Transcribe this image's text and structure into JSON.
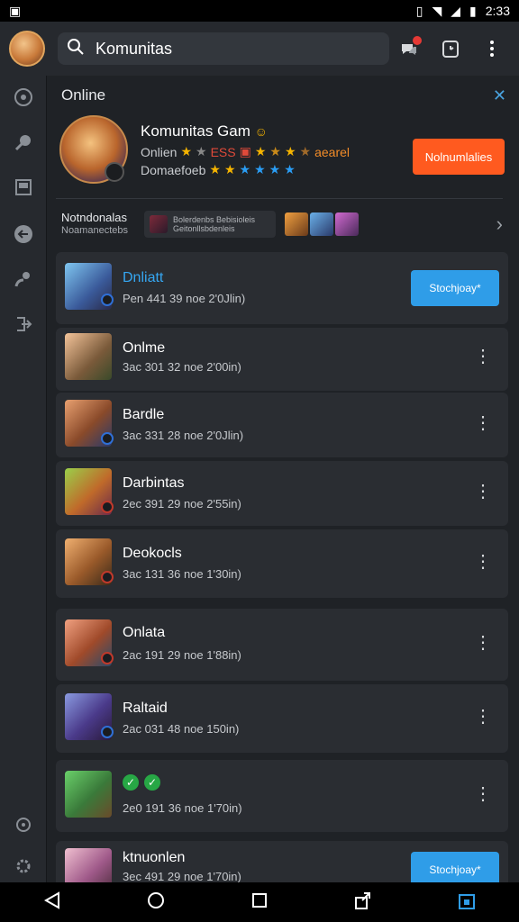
{
  "status": {
    "time": "2:33"
  },
  "search": {
    "value": "Komunitas"
  },
  "header": {
    "title": "Online",
    "close": "✕"
  },
  "feature": {
    "name": "Komunitas Gam",
    "line2_label": "Onlien",
    "line2_code": "ESS",
    "line2_tail": "aearel",
    "line3_label": "Domaefoeb",
    "button": "Nolnumlalies"
  },
  "notifications": {
    "title": "Notndonalas",
    "subtitle": "Noamanectebs",
    "chip_text": "Bolerdenbs Bebisioleis Geitonllsbdenleis"
  },
  "cards": [
    {
      "name": "Dnliatt",
      "meta": "Pen 441 39 noe 2'0Jlin)",
      "action": "Stochjoay*"
    },
    {
      "name": "Onlme",
      "meta": "3ac 301 32 noe 2'00in)"
    },
    {
      "name": "Bardle",
      "meta": "3ac 331 28 noe 2'0Jlin)"
    },
    {
      "name": "Darbintas",
      "meta": "2ec 391 29 noe 2'55in)"
    },
    {
      "name": "Deokocls",
      "meta": "3ac 131 36 noe 1'30in)"
    },
    {
      "name": "Onlata",
      "meta": "2ac 191 29 noe 1'88in)"
    },
    {
      "name": "Raltaid",
      "meta": "2ac 031 48 noe 150in)"
    },
    {
      "name": "",
      "meta": "2e0 191 36 noe 1'70in)"
    },
    {
      "name": "ktnuonlen",
      "meta": "3ec 491 29 noe 1'70in)",
      "action": "Stochjoay*"
    }
  ],
  "colors": {
    "accent_orange": "#ff5a1f",
    "accent_blue": "#2f9de8",
    "background": "#1f2226"
  }
}
